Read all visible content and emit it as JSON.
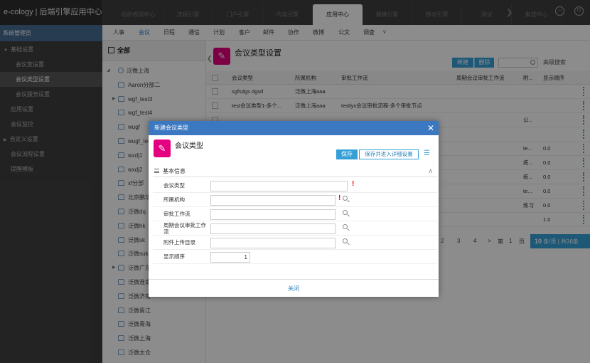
{
  "app": {
    "title": "e-cology | 后端引擎应用中心"
  },
  "topnav": {
    "tabs": [
      "组织权限中心",
      "流程引擎",
      "门户引擎",
      "内容引擎",
      "应用中心",
      "建模引擎",
      "移动引擎",
      "测试",
      "集成中心"
    ],
    "active": "应用中心"
  },
  "leftmenu": {
    "title": "系统管理员",
    "items": [
      {
        "label": "基础设置",
        "expanded": true
      },
      {
        "label": "会议室设置"
      },
      {
        "label": "会议类型设置",
        "selected": true
      },
      {
        "label": "会议服务设置"
      },
      {
        "label": "应用设置"
      },
      {
        "label": "会议监控"
      },
      {
        "label": "自定义设置",
        "collapsed": true
      },
      {
        "label": "会议流程设置"
      },
      {
        "label": "提醒模板"
      }
    ]
  },
  "subtabs": {
    "items": [
      "人事",
      "会议",
      "日程",
      "通信",
      "计划",
      "客户",
      "邮件",
      "协作",
      "微博",
      "公文",
      "调查"
    ],
    "active": "会议"
  },
  "tree": {
    "header": "全部",
    "nodes": [
      "泛微上海",
      "Aaron分部二",
      "wgf_test3",
      "wgf_test4",
      "wugf",
      "wugf_test",
      "wxdj1",
      "wxdj2",
      "xf分部",
      "北京鹏华",
      "泛微dq",
      "泛微hk",
      "泛微sk",
      "泛微suk",
      "泛微广东",
      "泛微淮南",
      "泛微济南",
      "泛微晋江",
      "泛微青海",
      "泛微上海",
      "泛微太仓"
    ]
  },
  "content": {
    "title": "会议类型设置",
    "new_label": "新建",
    "delete_label": "删除",
    "advanced_search": "高级搜索",
    "columns": [
      "会议类型",
      "所属机构",
      "审批工作流",
      "周期会议审批工作流",
      "附...",
      "显示顺序"
    ],
    "rows": [
      {
        "type": "sgfsdgs dgsd",
        "org": "泛微上海aaa",
        "wf": "",
        "cwf": "",
        "att": "",
        "order": ""
      },
      {
        "type": "test会议类型1-多个...",
        "org": "泛微上海aaa",
        "wf": "testlyx会议审批流程-多个审批节点",
        "cwf": "",
        "att": "",
        "order": ""
      },
      {
        "type": "",
        "org": "",
        "wf": "",
        "cwf": "",
        "att": "公...",
        "order": ""
      },
      {
        "type": "",
        "org": "",
        "wf": "",
        "cwf": "",
        "att": "",
        "order": ""
      },
      {
        "type": "",
        "org": "",
        "wf": "",
        "cwf": "",
        "att": "te...",
        "order": "0.0"
      },
      {
        "type": "",
        "org": "",
        "wf": "",
        "cwf": "",
        "att": "练...",
        "order": "0.0"
      },
      {
        "type": "",
        "org": "",
        "wf": "",
        "cwf": "",
        "att": "练...",
        "order": "0.0"
      },
      {
        "type": "",
        "org": "",
        "wf": "",
        "cwf": "",
        "att": "te...",
        "order": "0.0"
      },
      {
        "type": "",
        "org": "",
        "wf": "",
        "cwf": "",
        "att": "练习",
        "order": "0.0"
      },
      {
        "type": "",
        "org": "",
        "wf": "",
        "cwf": "",
        "att": "",
        "order": "1.0"
      }
    ]
  },
  "pager": {
    "pages": [
      "2",
      "3",
      "4"
    ],
    "next": ">",
    "goto_prefix": "第",
    "goto_page": "1",
    "goto_suffix": "页",
    "page_size": "10",
    "summary": "条/页 | 共36条"
  },
  "dialog": {
    "title": "新建会议类型",
    "heading": "会议类型",
    "save_label": "保存",
    "save_detail_label": "保存并进入详细设置",
    "section": "基本信息",
    "fields": [
      {
        "label": "会议类型",
        "value": ""
      },
      {
        "label": "所属机构",
        "value": ""
      },
      {
        "label": "审批工作流",
        "value": ""
      },
      {
        "label": "周期会议审批工作流",
        "value": ""
      },
      {
        "label": "附件上传目录",
        "value": ""
      },
      {
        "label": "显示顺序",
        "value": "1"
      }
    ],
    "close_label": "关闭"
  }
}
